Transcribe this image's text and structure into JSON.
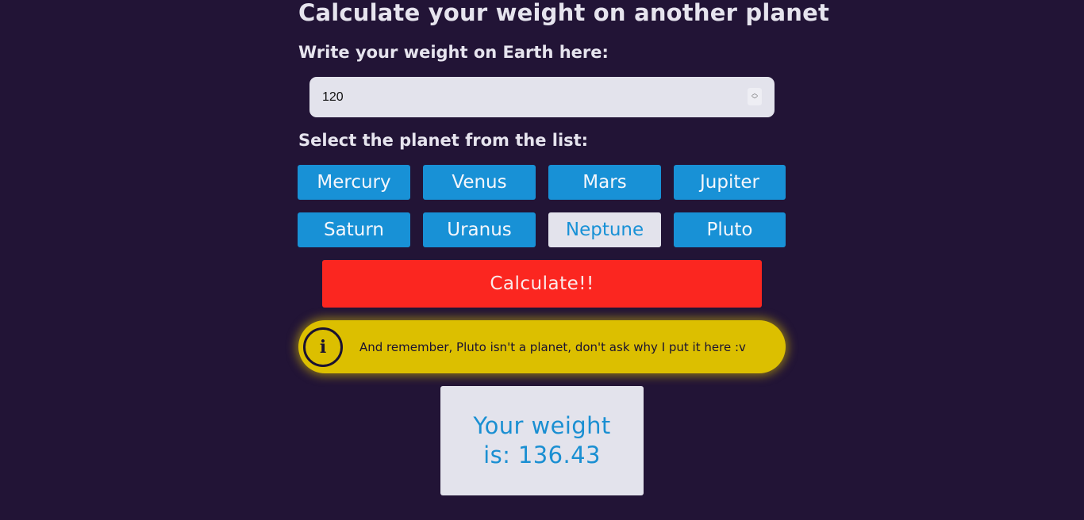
{
  "page": {
    "title": "Calculate your weight on another planet"
  },
  "form": {
    "weight_label": "Write your weight on Earth here:",
    "weight_value": "120",
    "planet_label": "Select the planet from the list:",
    "planets": [
      "Mercury",
      "Venus",
      "Mars",
      "Jupiter",
      "Saturn",
      "Uranus",
      "Neptune",
      "Pluto"
    ],
    "selected_planet": "Neptune",
    "calculate_label": "Calculate!!"
  },
  "notice": {
    "icon": "info-icon",
    "icon_glyph": "i",
    "text": "And remember, Pluto isn't a planet, don't ask why I put it here :v"
  },
  "result": {
    "text": "Your weight is: 136.43"
  },
  "colors": {
    "background": "#221436",
    "planet_button": "#1891d6",
    "selected_button": "#e3e3ec",
    "calculate_button": "#fb2620",
    "notice": "#dcbf00",
    "result_text": "#1a8fd2"
  }
}
